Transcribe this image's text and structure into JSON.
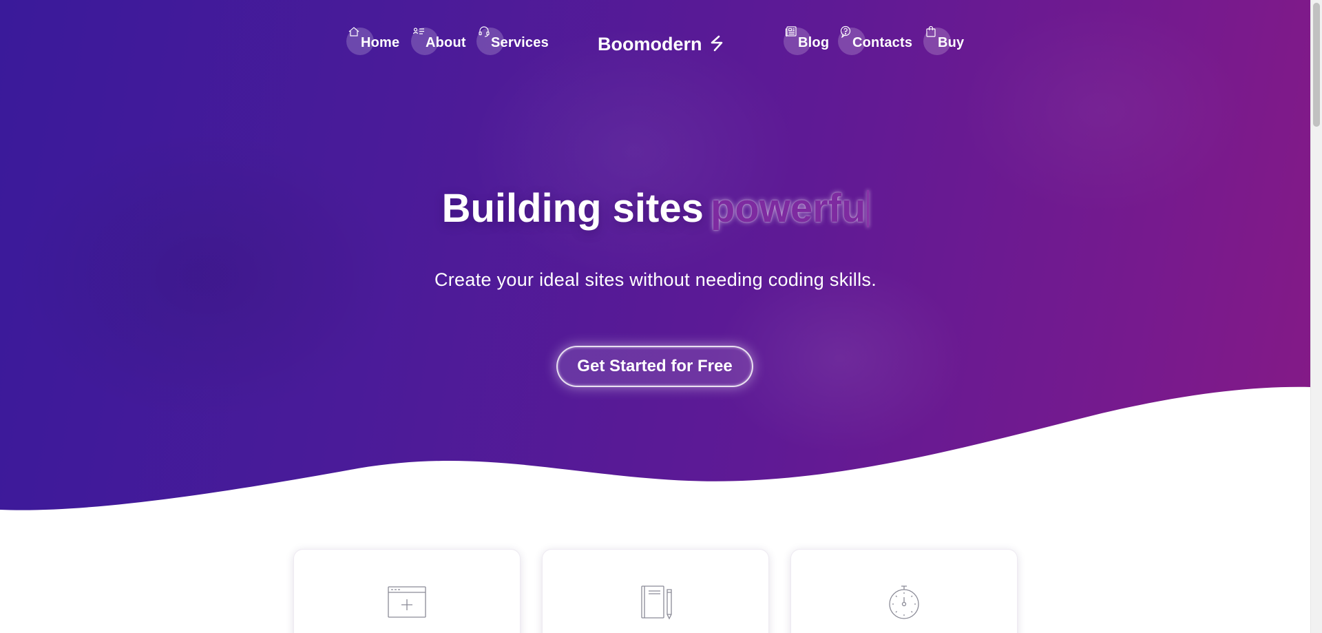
{
  "nav": {
    "left_items": [
      {
        "label": "Home",
        "icon": "home-icon"
      },
      {
        "label": "About",
        "icon": "id-card-icon"
      },
      {
        "label": "Services",
        "icon": "headset-icon"
      }
    ],
    "brand": "Boomodern",
    "brand_icon": "bolt-icon",
    "right_items": [
      {
        "label": "Blog",
        "icon": "newspaper-icon"
      },
      {
        "label": "Contacts",
        "icon": "question-icon"
      },
      {
        "label": "Buy",
        "icon": "shopping-bag-icon"
      }
    ]
  },
  "hero": {
    "headline": "Building sites",
    "headline_accent": "powerfu",
    "subheadline": "Create your ideal sites without needing coding skills.",
    "cta_label": "Get Started for Free"
  },
  "features": {
    "cards": [
      {
        "icon": "browser-add-icon"
      },
      {
        "icon": "notebook-pencil-icon"
      },
      {
        "icon": "stopwatch-icon"
      }
    ]
  },
  "colors": {
    "gradient_start": "#3a1a9a",
    "gradient_end": "#851a86",
    "accent_text": "#7e2aa0",
    "card_icon_stroke": "#8a8a96"
  }
}
